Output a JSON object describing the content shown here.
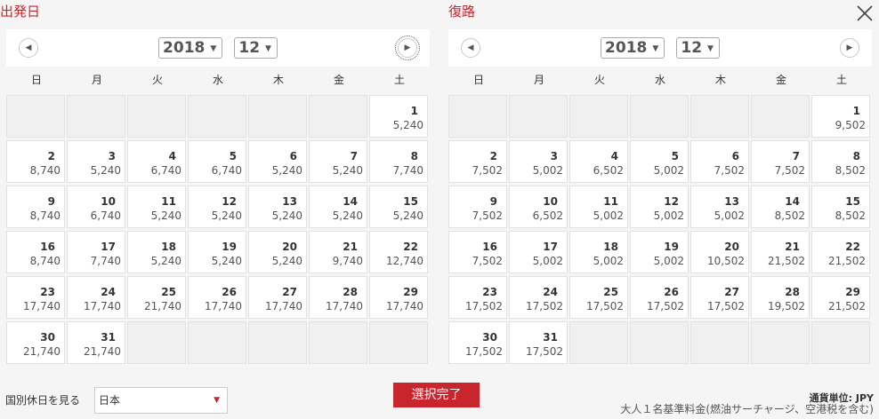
{
  "panels": [
    {
      "title": "出発日",
      "year": "2018",
      "month": "12",
      "weekdays": [
        "日",
        "月",
        "火",
        "水",
        "木",
        "金",
        "土"
      ],
      "leading_blanks": 6,
      "days": [
        {
          "day": "1",
          "price": "5,240"
        },
        {
          "day": "2",
          "price": "8,740"
        },
        {
          "day": "3",
          "price": "5,240"
        },
        {
          "day": "4",
          "price": "6,740"
        },
        {
          "day": "5",
          "price": "6,740"
        },
        {
          "day": "6",
          "price": "5,240"
        },
        {
          "day": "7",
          "price": "5,240"
        },
        {
          "day": "8",
          "price": "7,740"
        },
        {
          "day": "9",
          "price": "8,740"
        },
        {
          "day": "10",
          "price": "6,740"
        },
        {
          "day": "11",
          "price": "5,240"
        },
        {
          "day": "12",
          "price": "5,240"
        },
        {
          "day": "13",
          "price": "5,240"
        },
        {
          "day": "14",
          "price": "5,240"
        },
        {
          "day": "15",
          "price": "5,240"
        },
        {
          "day": "16",
          "price": "8,740"
        },
        {
          "day": "17",
          "price": "7,740"
        },
        {
          "day": "18",
          "price": "5,240"
        },
        {
          "day": "19",
          "price": "5,240"
        },
        {
          "day": "20",
          "price": "5,240"
        },
        {
          "day": "21",
          "price": "9,740"
        },
        {
          "day": "22",
          "price": "12,740"
        },
        {
          "day": "23",
          "price": "17,740"
        },
        {
          "day": "24",
          "price": "17,740"
        },
        {
          "day": "25",
          "price": "21,740"
        },
        {
          "day": "26",
          "price": "17,740"
        },
        {
          "day": "27",
          "price": "17,740"
        },
        {
          "day": "28",
          "price": "17,740"
        },
        {
          "day": "29",
          "price": "17,740"
        },
        {
          "day": "30",
          "price": "21,740"
        },
        {
          "day": "31",
          "price": "21,740"
        }
      ],
      "trailing_blanks": 5
    },
    {
      "title": "復路",
      "year": "2018",
      "month": "12",
      "weekdays": [
        "日",
        "月",
        "火",
        "水",
        "木",
        "金",
        "土"
      ],
      "leading_blanks": 6,
      "days": [
        {
          "day": "1",
          "price": "9,502"
        },
        {
          "day": "2",
          "price": "7,502"
        },
        {
          "day": "3",
          "price": "5,002"
        },
        {
          "day": "4",
          "price": "6,502"
        },
        {
          "day": "5",
          "price": "5,002"
        },
        {
          "day": "6",
          "price": "7,502"
        },
        {
          "day": "7",
          "price": "7,502"
        },
        {
          "day": "8",
          "price": "8,502"
        },
        {
          "day": "9",
          "price": "7,502"
        },
        {
          "day": "10",
          "price": "6,502"
        },
        {
          "day": "11",
          "price": "5,002"
        },
        {
          "day": "12",
          "price": "5,002"
        },
        {
          "day": "13",
          "price": "5,002"
        },
        {
          "day": "14",
          "price": "8,502"
        },
        {
          "day": "15",
          "price": "8,502"
        },
        {
          "day": "16",
          "price": "7,502"
        },
        {
          "day": "17",
          "price": "5,002"
        },
        {
          "day": "18",
          "price": "5,002"
        },
        {
          "day": "19",
          "price": "5,002"
        },
        {
          "day": "20",
          "price": "10,502"
        },
        {
          "day": "21",
          "price": "21,502"
        },
        {
          "day": "22",
          "price": "21,502"
        },
        {
          "day": "23",
          "price": "17,502"
        },
        {
          "day": "24",
          "price": "17,502"
        },
        {
          "day": "25",
          "price": "17,502"
        },
        {
          "day": "26",
          "price": "17,502"
        },
        {
          "day": "27",
          "price": "17,502"
        },
        {
          "day": "28",
          "price": "19,502"
        },
        {
          "day": "29",
          "price": "21,502"
        },
        {
          "day": "30",
          "price": "17,502"
        },
        {
          "day": "31",
          "price": "17,502"
        }
      ],
      "trailing_blanks": 5
    }
  ],
  "icons": {
    "prev": "chevron-left-icon",
    "next": "chevron-right-icon",
    "close": "close-icon",
    "dropdown": "dropdown-caret-icon"
  },
  "footer": {
    "holiday_label": "国別休日を見る",
    "country_value": "日本",
    "confirm_label": "選択完了",
    "currency_label": "通貨単位: JPY",
    "fare_note": "大人１名基準料金(燃油サーチャージ、空港税を含む)"
  },
  "colors": {
    "accent": "#c8262c",
    "background": "#f5f5f5",
    "cell_empty": "#f0f0f0"
  }
}
